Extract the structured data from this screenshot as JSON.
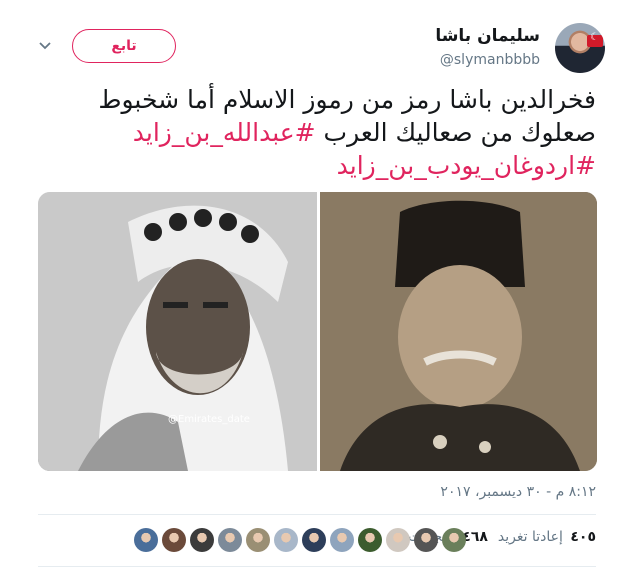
{
  "user": {
    "name": "سليمان باشا",
    "handle": "@slymanbbbb"
  },
  "follow_button": {
    "label": "تابع"
  },
  "tweet": {
    "line1": "فخرالدين باشا رمز من رموز الاسلام أما شخبوط",
    "line2_text": "صعلوك من صعاليك العرب ",
    "hashtag1": "#عبدالله_بن_زايد",
    "hashtag2": "#اردوغان_يودب_بن_زايد"
  },
  "photo_watermark": "@Emirates_date",
  "timestamp": "٨:١٢ م - ٣٠ ديسمبر، ٢٠١٧",
  "stats": {
    "retweets": {
      "count": "٤٠٥",
      "label": "إعادتا تغريد"
    },
    "likes": {
      "count": "٤٦٨",
      "label": "إعجابات"
    }
  },
  "liker_avatars": [
    "#4a6e9a",
    "#6b4a3a",
    "#3b3b3b",
    "#7c8a99",
    "#9a8f74",
    "#a8b7c9",
    "#2d3e5a",
    "#8ea4bd",
    "#3c5c2e",
    "#d0c8c0",
    "#555555",
    "#6a7f5b"
  ],
  "icons": {
    "caret": "chevron-down-icon"
  }
}
